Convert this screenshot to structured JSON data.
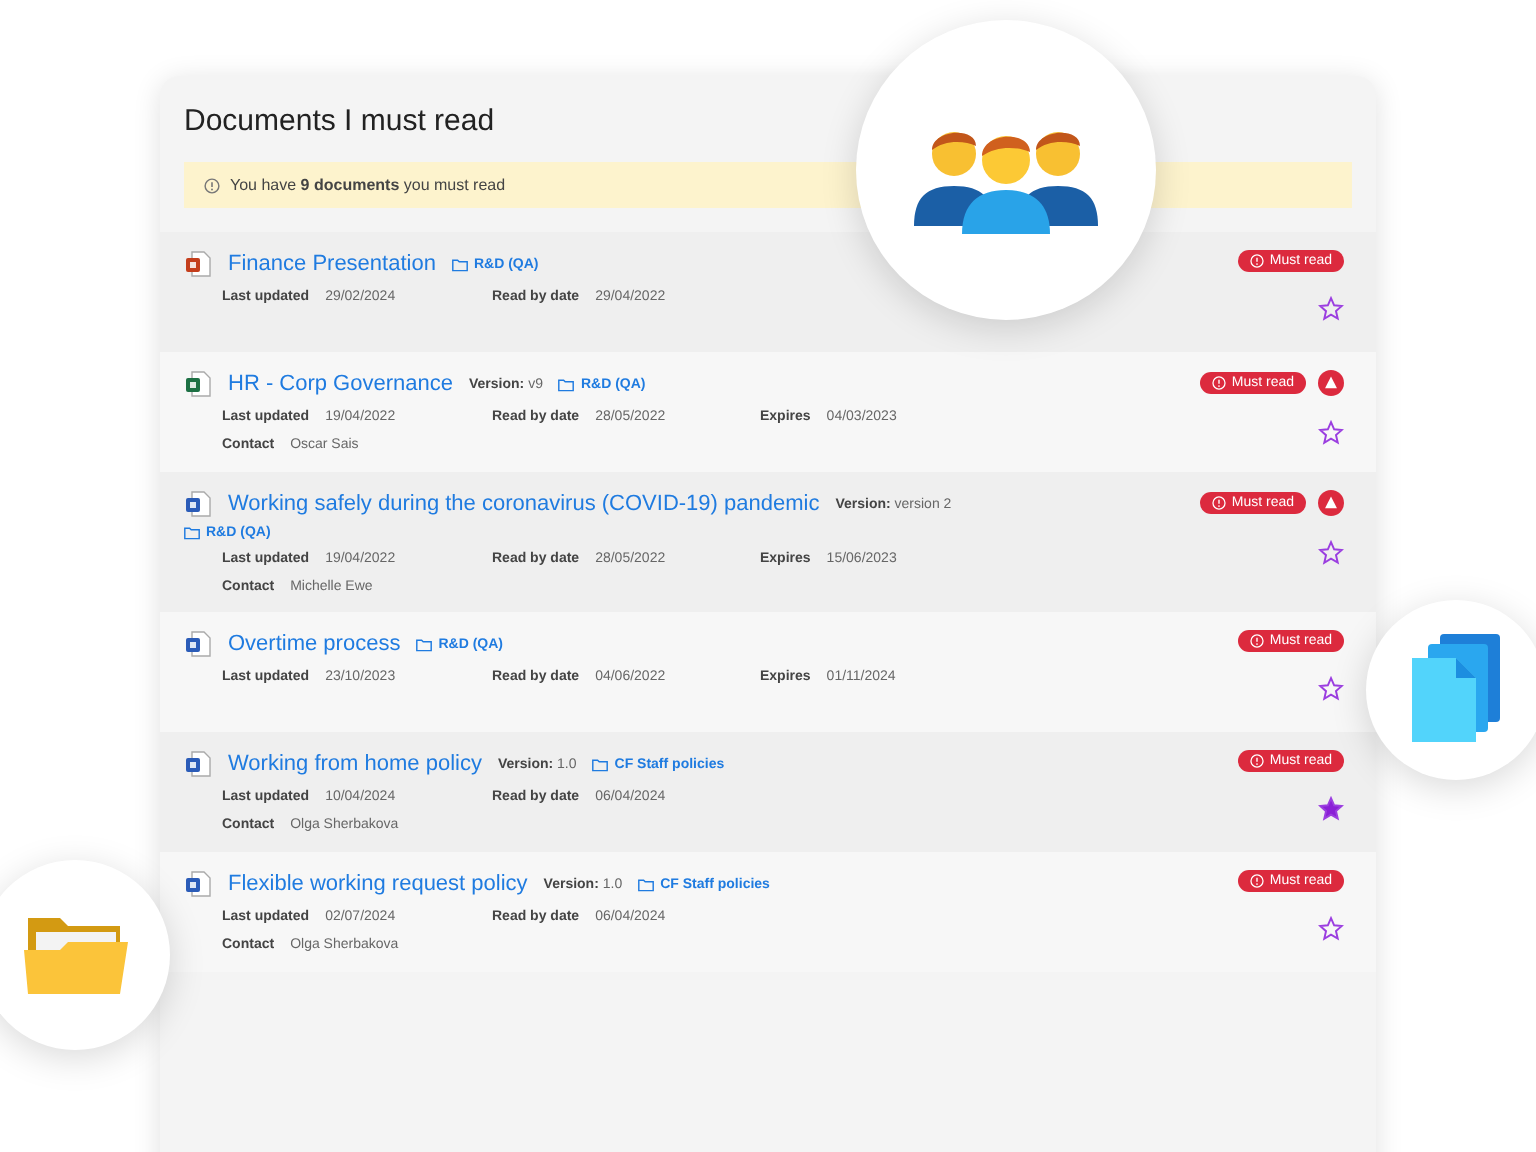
{
  "title": "Documents I must read",
  "notice": "You have **9 documents** you must read",
  "documents": [
    {
      "kind": "presentation",
      "title": "Finance Presentation",
      "folder": "R&D (QA)",
      "dates": [
        {
          "label": "Last updated",
          "value": "29/02/2024"
        },
        {
          "label": "Read by date",
          "value": "29/04/2022"
        }
      ],
      "badge": "Must read",
      "must_read": true,
      "warning": false,
      "starred": false
    },
    {
      "kind": "spreadsheet",
      "title": "HR - Corp Governance",
      "version_label": "Version:",
      "version": "v9",
      "folder": "R&D (QA)",
      "dates": [
        {
          "label": "Last updated",
          "value": "19/04/2022"
        },
        {
          "label": "Read by date",
          "value": "28/05/2022"
        },
        {
          "label": "Expires",
          "value": "04/03/2023"
        }
      ],
      "contact": {
        "label": "Contact",
        "value": "Oscar Sais"
      },
      "badge": "Must read",
      "must_read": true,
      "warning": true,
      "starred": false
    },
    {
      "kind": "document",
      "title": "Working safely during the coronavirus (COVID-19) pandemic",
      "version_label": "Version:",
      "version": "version 2",
      "folder": "R&D (QA)",
      "dates": [
        {
          "label": "Last updated",
          "value": "19/04/2022"
        },
        {
          "label": "Read by date",
          "value": "28/05/2022"
        },
        {
          "label": "Expires",
          "value": "15/06/2023"
        }
      ],
      "contact": {
        "label": "Contact",
        "value": "Michelle Ewe"
      },
      "badge": "Must read",
      "must_read": true,
      "warning": true,
      "starred": false
    },
    {
      "kind": "document",
      "title": "Overtime process",
      "folder": "R&D (QA)",
      "dates": [
        {
          "label": "Last updated",
          "value": "23/10/2023"
        },
        {
          "label": "Read by date",
          "value": "04/06/2022"
        },
        {
          "label": "Expires",
          "value": "01/11/2024"
        }
      ],
      "badge": "Must read",
      "must_read": true,
      "warning": false,
      "starred": false
    },
    {
      "kind": "document",
      "title": "Working from home policy",
      "version_label": "Version:",
      "version": "1.0",
      "folder": "CF Staff policies",
      "dates": [
        {
          "label": "Last updated",
          "value": "10/04/2024"
        },
        {
          "label": "Read by date",
          "value": "06/04/2024"
        }
      ],
      "contact": {
        "label": "Contact",
        "value": "Olga Sherbakova"
      },
      "badge": "Must read",
      "must_read": true,
      "warning": false,
      "starred": true
    },
    {
      "kind": "document",
      "title": "Flexible working request policy",
      "version_label": "Version:",
      "version": "1.0",
      "folder": "CF Staff policies",
      "dates": [
        {
          "label": "Last updated",
          "value": "02/07/2024"
        },
        {
          "label": "Read by date",
          "value": "06/04/2024"
        }
      ],
      "contact": {
        "label": "Contact",
        "value": "Olga Sherbakova"
      },
      "badge": "Must read",
      "must_read": true,
      "warning": false,
      "starred": false
    }
  ]
}
